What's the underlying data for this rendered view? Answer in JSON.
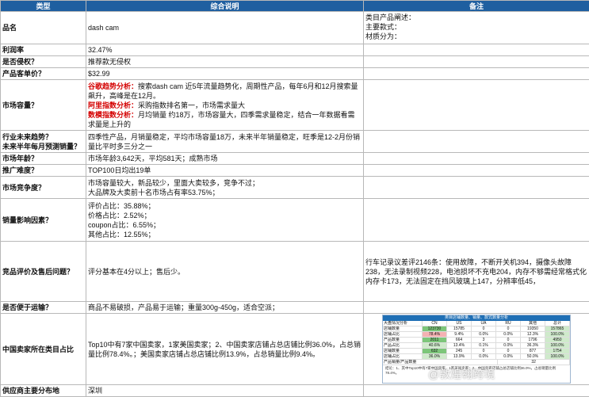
{
  "headers": {
    "type": "类型",
    "desc": "综合说明",
    "notes": "备注"
  },
  "rows": {
    "name": {
      "label": "品名",
      "desc": "dash cam",
      "notes": [
        "类目产品阐述：",
        "主要款式：",
        "材质分为："
      ]
    },
    "margin": {
      "label": "利润率",
      "desc": "32.47%"
    },
    "infringe": {
      "label": "是否侵权？",
      "desc": "推荐款无侵权"
    },
    "price": {
      "label": "产品客单价？",
      "desc": "$32.99"
    },
    "capacity": {
      "label": "市场容量？",
      "l1_red": "谷歌趋势分析：",
      "l1": "搜索dash cam 近5年流量趋势化，周期性产品，每年6月和12月搜索量飙升，高峰是在12月。",
      "l2_red": "阿里指数分析：",
      "l2": "采购指数排名第一，市场需求量大",
      "l3_red": "数模指数分析：",
      "l3": "月均销量 约18万，市场容量大，四季需求量稳定，结合一年数据看需求量是上升的"
    },
    "trend": {
      "label1": "行业未来趋势？",
      "label2": "未来半年每月预测销量？",
      "desc": "四季性产品，月销量稳定，平均市场容量18万，未来半年销量稳定，旺季是12-2月份销量比平时多三分之一"
    },
    "age": {
      "label": "市场年龄？",
      "desc": "市场年龄3,642天，平均581天；成熟市场"
    },
    "promo": {
      "label": "推广难度？",
      "desc": "TOP100日均出19单"
    },
    "competition": {
      "label": "市场竞争度？",
      "l1": "市场容量较大，新品较少，里面大卖较多，竞争不过；",
      "l2": "大品牌及大卖前十名市场占有率53.75%；"
    },
    "factors": {
      "label": "销量影响因素？",
      "items": [
        "评价占比：35.88%；",
        "价格占比：2.52%；",
        "coupon占比：6.55%；",
        "其他占比：12.55%；"
      ]
    },
    "reviews": {
      "label": "竞品评价及售后问题？",
      "desc": "评分基本在4分以上；售后少。",
      "notes": "行车记录议差评2146条：使用故障，不断开关机394，摄像头故障238，无法录制视频228，电池损坏不充电204，内存不够需经常格式化内存卡173，无法固定在挡风玻璃上147，分辨率低45，"
    },
    "shipping": {
      "label": "是否便于运输？",
      "desc": "商品不易破损，产品易于运输；重量300g-450g，适合空派；"
    },
    "sellers": {
      "label": "中国卖家所在类目占比",
      "desc": "Top10中有7家中国卖家，1家美国卖家；2、中国卖家店铺占总店铺比例36.0%，占总销量比例78.4%。；美国卖家店铺占总店铺比例13.9%，占总销量比例9.4%。",
      "mini": {
        "title": "类目店铺数量、销量、款式数量分析",
        "header": [
          "大盘情况分析",
          "CN",
          "US",
          "UA",
          "RU",
          "其他",
          "总计"
        ],
        "rows": [
          [
            "店铺数量",
            "123730",
            "15785",
            "0",
            "0",
            "19350",
            "157865"
          ],
          [
            "店铺占比",
            "78.4%",
            "9.4%",
            "0.0%",
            "0.0%",
            "12.3%",
            "100.0%"
          ],
          [
            "产品数量",
            "2011",
            "664",
            "3",
            "0",
            "1796",
            "4950"
          ],
          [
            "产品占比",
            "40.6%",
            "13.4%",
            "0.1%",
            "0.0%",
            "36.3%",
            "100.0%"
          ],
          [
            "店铺数量",
            "632",
            "245",
            "0",
            "0",
            "877",
            "1754"
          ],
          [
            "店铺占比",
            "36.0%",
            "13.9%",
            "0.0%",
            "0.0%",
            "50.0%",
            "100.0%"
          ]
        ],
        "side": "产品销量/产品数量",
        "side_val": "32",
        "note": "结论：1、其中Top10中有7家中国卖家，1家美国卖家；2、中国卖家店铺占总店铺比例36.0%，占总销量比例78.4%。"
      }
    },
    "supply": {
      "label": "供应商主要分布地",
      "desc": "深圳"
    }
  },
  "watermark": "@敦煌翱跨境"
}
